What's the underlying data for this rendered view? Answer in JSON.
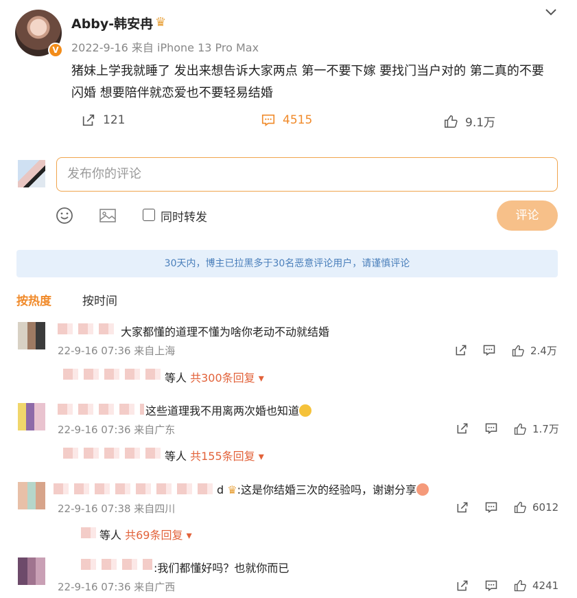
{
  "post": {
    "author": "Abby-韩安冉",
    "crown_icon": "crown-icon",
    "verified_badge": "V",
    "date": "2022-9-16",
    "source": "来自 iPhone 13 Pro Max",
    "text": "猪妹上学我就睡了 发出来想告诉大家两点 第一不要下嫁 要找门当户对的 第二真的不要闪婚  想要陪伴就恋爱也不要轻易结婚",
    "repost_count": "121",
    "comment_count": "4515",
    "like_count": "9.1万"
  },
  "composer": {
    "placeholder": "发布你的评论",
    "repost_label": "同时转发",
    "submit_label": "评论"
  },
  "notice": "30天内，博主已拉黑多于30名恶意评论用户，请谨慎评论",
  "sort_tabs": [
    "按热度",
    "按时间"
  ],
  "comments": [
    {
      "text": "大家都懂的道理不懂为啥你老动不动就结婚",
      "time": "22-9-16 07:36 来自上海",
      "likes": "2.4万",
      "reply_prefix": "等人",
      "reply_count": "共300条回复"
    },
    {
      "text": "这些道理我不用离两次婚也知道",
      "time": "22-9-16 07:36 来自广东",
      "likes": "1.7万",
      "reply_prefix": "等人",
      "reply_count": "共155条回复"
    },
    {
      "name_fragment": "d",
      "text": ":这是你结婚三次的经验吗，谢谢分享",
      "time": "22-9-16 07:38 来自四川",
      "likes": "6012",
      "reply_prefix": "等人",
      "reply_count": "共69条回复"
    },
    {
      "text": ":我们都懂好吗？也就你而已",
      "time": "22-9-16 07:36 来自广西",
      "likes": "4241"
    }
  ]
}
